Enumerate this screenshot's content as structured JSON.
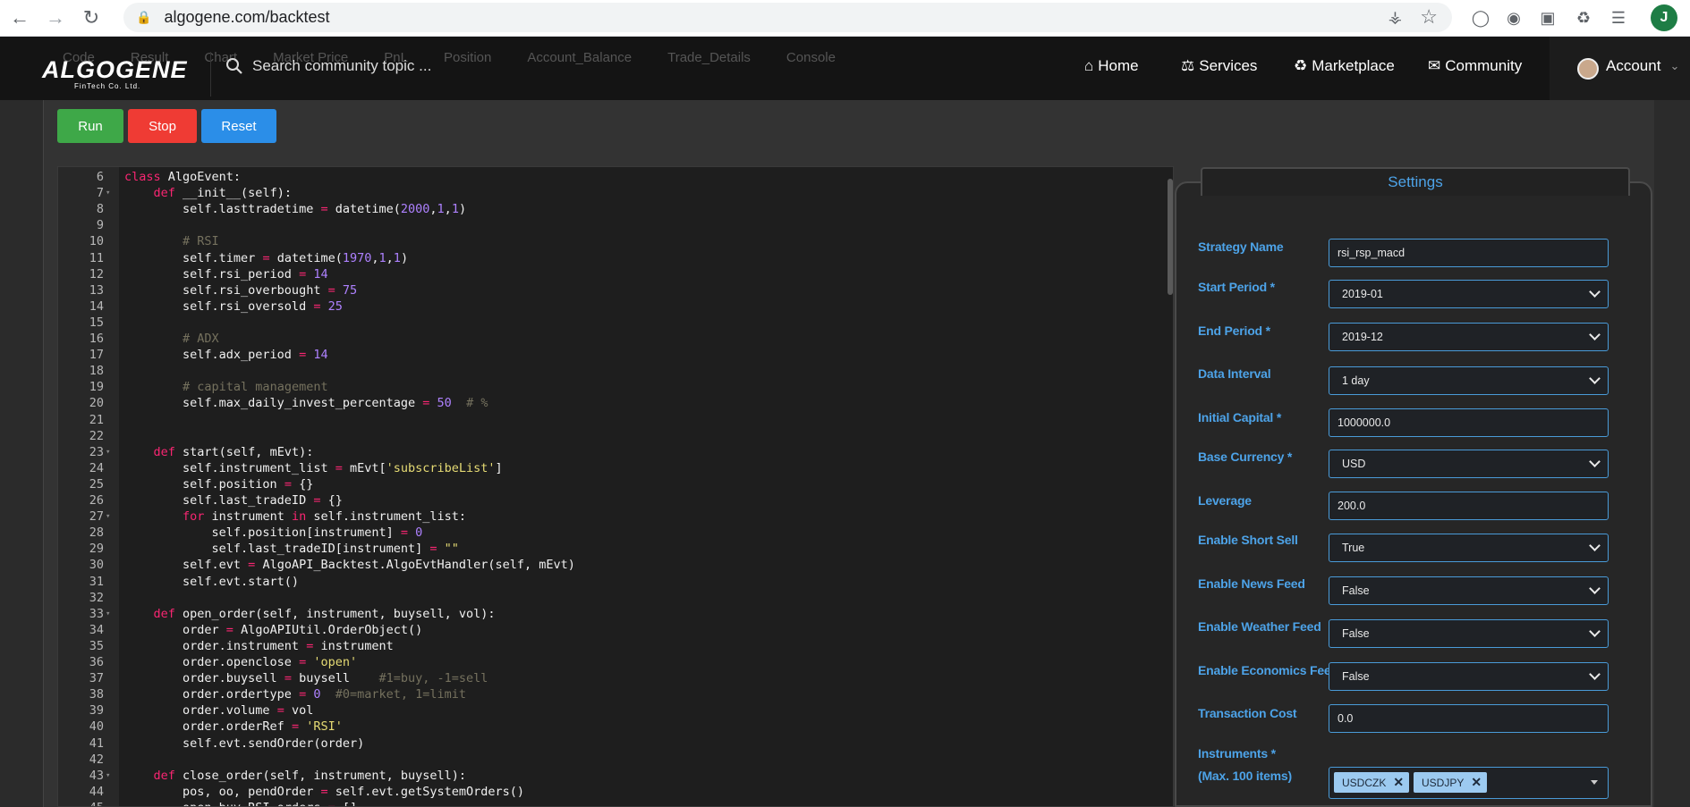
{
  "browser": {
    "url": "algogene.com/backtest",
    "profile_initial": "J"
  },
  "site": {
    "logo": "ALGOGENE",
    "logo_sub": "FinTech Co. Ltd.",
    "search_placeholder": "Search community topic ...",
    "ghost_tabs": [
      "Code",
      "Result",
      "Chart",
      "Market Price",
      "PnL",
      "Position",
      "Account_Balance",
      "Trade_Details",
      "Console"
    ],
    "nav": {
      "home": "Home",
      "services": "Services",
      "marketplace": "Marketplace",
      "community": "Community",
      "account": "Account"
    }
  },
  "toolbar": {
    "run": "Run",
    "stop": "Stop",
    "reset": "Reset"
  },
  "editor": {
    "lines": [
      {
        "n": "6",
        "fold": false,
        "seg": [
          [
            "kw",
            "class"
          ],
          [
            "t",
            " AlgoEvent:"
          ]
        ]
      },
      {
        "n": "7",
        "fold": true,
        "seg": [
          [
            "t",
            "    "
          ],
          [
            "kw",
            "def"
          ],
          [
            "t",
            " __init__(self):"
          ]
        ]
      },
      {
        "n": "8",
        "fold": false,
        "seg": [
          [
            "t",
            "        self.lasttradetime "
          ],
          [
            "kw",
            "="
          ],
          [
            "t",
            " datetime("
          ],
          [
            "num",
            "2000"
          ],
          [
            "t",
            ","
          ],
          [
            "num",
            "1"
          ],
          [
            "t",
            ","
          ],
          [
            "num",
            "1"
          ],
          [
            "t",
            ")"
          ]
        ]
      },
      {
        "n": "9",
        "fold": false,
        "seg": []
      },
      {
        "n": "10",
        "fold": false,
        "seg": [
          [
            "t",
            "        "
          ],
          [
            "cm",
            "# RSI"
          ]
        ]
      },
      {
        "n": "11",
        "fold": false,
        "seg": [
          [
            "t",
            "        self.timer "
          ],
          [
            "kw",
            "="
          ],
          [
            "t",
            " datetime("
          ],
          [
            "num",
            "1970"
          ],
          [
            "t",
            ","
          ],
          [
            "num",
            "1"
          ],
          [
            "t",
            ","
          ],
          [
            "num",
            "1"
          ],
          [
            "t",
            ")"
          ]
        ]
      },
      {
        "n": "12",
        "fold": false,
        "seg": [
          [
            "t",
            "        self.rsi_period "
          ],
          [
            "kw",
            "="
          ],
          [
            "t",
            " "
          ],
          [
            "num",
            "14"
          ]
        ]
      },
      {
        "n": "13",
        "fold": false,
        "seg": [
          [
            "t",
            "        self.rsi_overbought "
          ],
          [
            "kw",
            "="
          ],
          [
            "t",
            " "
          ],
          [
            "num",
            "75"
          ]
        ]
      },
      {
        "n": "14",
        "fold": false,
        "seg": [
          [
            "t",
            "        self.rsi_oversold "
          ],
          [
            "kw",
            "="
          ],
          [
            "t",
            " "
          ],
          [
            "num",
            "25"
          ]
        ]
      },
      {
        "n": "15",
        "fold": false,
        "seg": []
      },
      {
        "n": "16",
        "fold": false,
        "seg": [
          [
            "t",
            "        "
          ],
          [
            "cm",
            "# ADX"
          ]
        ]
      },
      {
        "n": "17",
        "fold": false,
        "seg": [
          [
            "t",
            "        self.adx_period "
          ],
          [
            "kw",
            "="
          ],
          [
            "t",
            " "
          ],
          [
            "num",
            "14"
          ]
        ]
      },
      {
        "n": "18",
        "fold": false,
        "seg": []
      },
      {
        "n": "19",
        "fold": false,
        "seg": [
          [
            "t",
            "        "
          ],
          [
            "cm",
            "# capital management"
          ]
        ]
      },
      {
        "n": "20",
        "fold": false,
        "seg": [
          [
            "t",
            "        self.max_daily_invest_percentage "
          ],
          [
            "kw",
            "="
          ],
          [
            "t",
            " "
          ],
          [
            "num",
            "50"
          ],
          [
            "t",
            "  "
          ],
          [
            "cm",
            "# %"
          ]
        ]
      },
      {
        "n": "21",
        "fold": false,
        "seg": []
      },
      {
        "n": "22",
        "fold": false,
        "seg": []
      },
      {
        "n": "23",
        "fold": true,
        "seg": [
          [
            "t",
            "    "
          ],
          [
            "kw",
            "def"
          ],
          [
            "t",
            " start(self, mEvt):"
          ]
        ]
      },
      {
        "n": "24",
        "fold": false,
        "seg": [
          [
            "t",
            "        self.instrument_list "
          ],
          [
            "kw",
            "="
          ],
          [
            "t",
            " mEvt["
          ],
          [
            "str",
            "'subscribeList'"
          ],
          [
            "t",
            "]"
          ]
        ]
      },
      {
        "n": "25",
        "fold": false,
        "seg": [
          [
            "t",
            "        self.position "
          ],
          [
            "kw",
            "="
          ],
          [
            "t",
            " {}"
          ]
        ]
      },
      {
        "n": "26",
        "fold": false,
        "seg": [
          [
            "t",
            "        self.last_tradeID "
          ],
          [
            "kw",
            "="
          ],
          [
            "t",
            " {}"
          ]
        ]
      },
      {
        "n": "27",
        "fold": true,
        "seg": [
          [
            "t",
            "        "
          ],
          [
            "kw",
            "for"
          ],
          [
            "t",
            " instrument "
          ],
          [
            "kw",
            "in"
          ],
          [
            "t",
            " self.instrument_list:"
          ]
        ]
      },
      {
        "n": "28",
        "fold": false,
        "seg": [
          [
            "t",
            "            self.position[instrument] "
          ],
          [
            "kw",
            "="
          ],
          [
            "t",
            " "
          ],
          [
            "num",
            "0"
          ]
        ]
      },
      {
        "n": "29",
        "fold": false,
        "seg": [
          [
            "t",
            "            self.last_tradeID[instrument] "
          ],
          [
            "kw",
            "="
          ],
          [
            "t",
            " "
          ],
          [
            "str",
            "\"\""
          ]
        ]
      },
      {
        "n": "30",
        "fold": false,
        "seg": [
          [
            "t",
            "        self.evt "
          ],
          [
            "kw",
            "="
          ],
          [
            "t",
            " AlgoAPI_Backtest.AlgoEvtHandler(self, mEvt)"
          ]
        ]
      },
      {
        "n": "31",
        "fold": false,
        "seg": [
          [
            "t",
            "        self.evt.start()"
          ]
        ]
      },
      {
        "n": "32",
        "fold": false,
        "seg": []
      },
      {
        "n": "33",
        "fold": true,
        "seg": [
          [
            "t",
            "    "
          ],
          [
            "kw",
            "def"
          ],
          [
            "t",
            " open_order(self, instrument, buysell, vol):"
          ]
        ]
      },
      {
        "n": "34",
        "fold": false,
        "seg": [
          [
            "t",
            "        order "
          ],
          [
            "kw",
            "="
          ],
          [
            "t",
            " AlgoAPIUtil.OrderObject()"
          ]
        ]
      },
      {
        "n": "35",
        "fold": false,
        "seg": [
          [
            "t",
            "        order.instrument "
          ],
          [
            "kw",
            "="
          ],
          [
            "t",
            " instrument"
          ]
        ]
      },
      {
        "n": "36",
        "fold": false,
        "seg": [
          [
            "t",
            "        order.openclose "
          ],
          [
            "kw",
            "="
          ],
          [
            "t",
            " "
          ],
          [
            "str",
            "'open'"
          ]
        ]
      },
      {
        "n": "37",
        "fold": false,
        "seg": [
          [
            "t",
            "        order.buysell "
          ],
          [
            "kw",
            "="
          ],
          [
            "t",
            " buysell    "
          ],
          [
            "cm",
            "#1=buy, -1=sell"
          ]
        ]
      },
      {
        "n": "38",
        "fold": false,
        "seg": [
          [
            "t",
            "        order.ordertype "
          ],
          [
            "kw",
            "="
          ],
          [
            "t",
            " "
          ],
          [
            "num",
            "0"
          ],
          [
            "t",
            "  "
          ],
          [
            "cm",
            "#0=market, 1=limit"
          ]
        ]
      },
      {
        "n": "39",
        "fold": false,
        "seg": [
          [
            "t",
            "        order.volume "
          ],
          [
            "kw",
            "="
          ],
          [
            "t",
            " vol"
          ]
        ]
      },
      {
        "n": "40",
        "fold": false,
        "seg": [
          [
            "t",
            "        order.orderRef "
          ],
          [
            "kw",
            "="
          ],
          [
            "t",
            " "
          ],
          [
            "str",
            "'RSI'"
          ]
        ]
      },
      {
        "n": "41",
        "fold": false,
        "seg": [
          [
            "t",
            "        self.evt.sendOrder(order)"
          ]
        ]
      },
      {
        "n": "42",
        "fold": false,
        "seg": []
      },
      {
        "n": "43",
        "fold": true,
        "seg": [
          [
            "t",
            "    "
          ],
          [
            "kw",
            "def"
          ],
          [
            "t",
            " close_order(self, instrument, buysell):"
          ]
        ]
      },
      {
        "n": "44",
        "fold": false,
        "seg": [
          [
            "t",
            "        pos, oo, pendOrder "
          ],
          [
            "kw",
            "="
          ],
          [
            "t",
            " self.evt.getSystemOrders()"
          ]
        ]
      },
      {
        "n": "45",
        "fold": false,
        "seg": [
          [
            "t",
            "        open_buy_RSI_orders "
          ],
          [
            "kw",
            "="
          ],
          [
            "t",
            " []"
          ]
        ]
      }
    ]
  },
  "settings": {
    "title": "Settings",
    "strategy_name": {
      "label": "Strategy Name",
      "value": "rsi_rsp_macd"
    },
    "start_period": {
      "label": "Start Period *",
      "value": "2019-01"
    },
    "end_period": {
      "label": "End Period *",
      "value": "2019-12"
    },
    "data_interval": {
      "label": "Data Interval",
      "value": "1 day"
    },
    "initial_capital": {
      "label": "Initial Capital *",
      "value": "1000000.0"
    },
    "base_currency": {
      "label": "Base Currency *",
      "value": "USD"
    },
    "leverage": {
      "label": "Leverage",
      "value": "200.0"
    },
    "short_sell": {
      "label": "Enable Short Sell",
      "value": "True"
    },
    "news_feed": {
      "label": "Enable News Feed",
      "value": "False"
    },
    "weather_feed": {
      "label": "Enable Weather Feed",
      "value": "False"
    },
    "economics_feed": {
      "label": "Enable Economics Feed",
      "value": "False"
    },
    "transaction_cost": {
      "label": "Transaction Cost",
      "value": "0.0"
    },
    "instruments": {
      "label": "Instruments *",
      "sublabel": "(Max. 100 items)",
      "values": [
        "USDCZK",
        "USDJPY"
      ]
    }
  },
  "colors": {
    "run": "#3ea848",
    "stop": "#ef3b34",
    "reset": "#2b8ee8",
    "accent": "#4da3e8"
  }
}
